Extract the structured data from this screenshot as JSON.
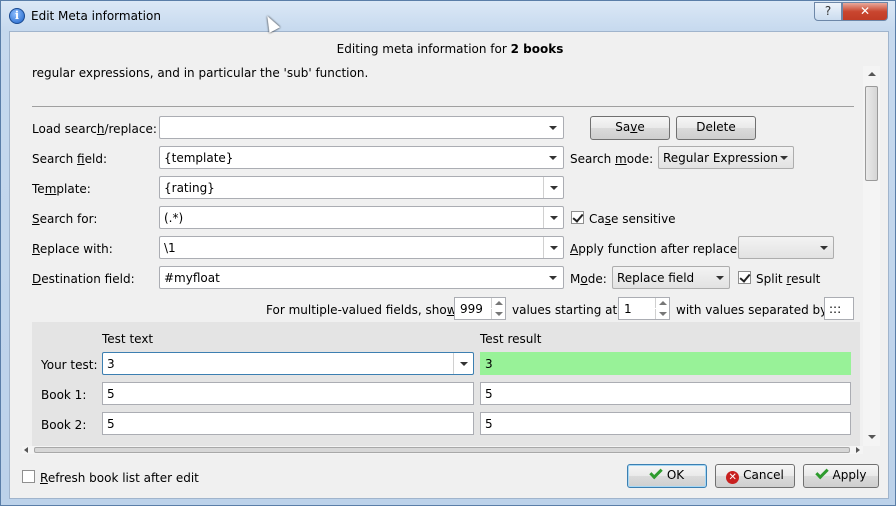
{
  "window": {
    "title": "Edit Meta information",
    "help_label": "?",
    "close_label": "✕"
  },
  "heading": {
    "prefix": "Editing meta information for ",
    "count": "2 books"
  },
  "description": "regular expressions, and in particular the 'sub' function.",
  "form": {
    "load_label_pre": "Load searc",
    "load_label_u": "h",
    "load_label_post": "/replace:",
    "load_value": "",
    "save_label_pre": "Sa",
    "save_label_u": "v",
    "save_label_post": "e",
    "delete_label": "Delete",
    "search_field_label_pre": "Search ",
    "search_field_label_u": "f",
    "search_field_label_post": "ield:",
    "search_field_value": "{template}",
    "search_mode_label_pre": "Search ",
    "search_mode_label_u": "m",
    "search_mode_label_post": "ode:",
    "search_mode_value": "Regular Expression",
    "template_label_pre": "Te",
    "template_label_u": "m",
    "template_label_post": "plate:",
    "template_value": "{rating}",
    "search_for_label_u": "S",
    "search_for_label_post": "earch for:",
    "search_for_value": "(.*)",
    "case_sensitive_pre": "Ca",
    "case_sensitive_u": "s",
    "case_sensitive_post": "e sensitive",
    "case_sensitive_checked": true,
    "replace_label_u": "R",
    "replace_label_post": "eplace with:",
    "replace_value": "\\1",
    "apply_fn_label_u": "A",
    "apply_fn_label_post": "pply function after replace:",
    "apply_fn_value": "",
    "dest_label_u": "D",
    "dest_label_post": "estination field:",
    "dest_value": "#myfloat",
    "mode_label_pre": "M",
    "mode_label_u": "o",
    "mode_label_post": "de:",
    "mode_value": "Replace field",
    "split_pre": "Split ",
    "split_u": "r",
    "split_post": "esult",
    "split_checked": true,
    "multi_pre": "For multiple-valued fields, sho",
    "multi_u": "w",
    "multi_count": "999",
    "multi_mid_pre": "values starting at",
    "multi_start": "1",
    "multi_sep_label": "with values separated by",
    "multi_sep_value": ":::"
  },
  "test": {
    "col_text": "Test text",
    "col_result": "Test result",
    "rows": [
      {
        "label": "Your test:",
        "text": "3",
        "result": "3"
      },
      {
        "label": "Book 1:",
        "text": "5",
        "result": "5"
      },
      {
        "label": "Book 2:",
        "text": "5",
        "result": "5"
      }
    ]
  },
  "footer": {
    "refresh_label_u": "R",
    "refresh_label_post": "efresh book list after edit",
    "refresh_checked": false,
    "ok_label": "OK",
    "cancel_label": "Cancel",
    "apply_label": "Apply"
  },
  "colors": {
    "result_ok": "#98f298",
    "close_button": "#c9462f"
  }
}
